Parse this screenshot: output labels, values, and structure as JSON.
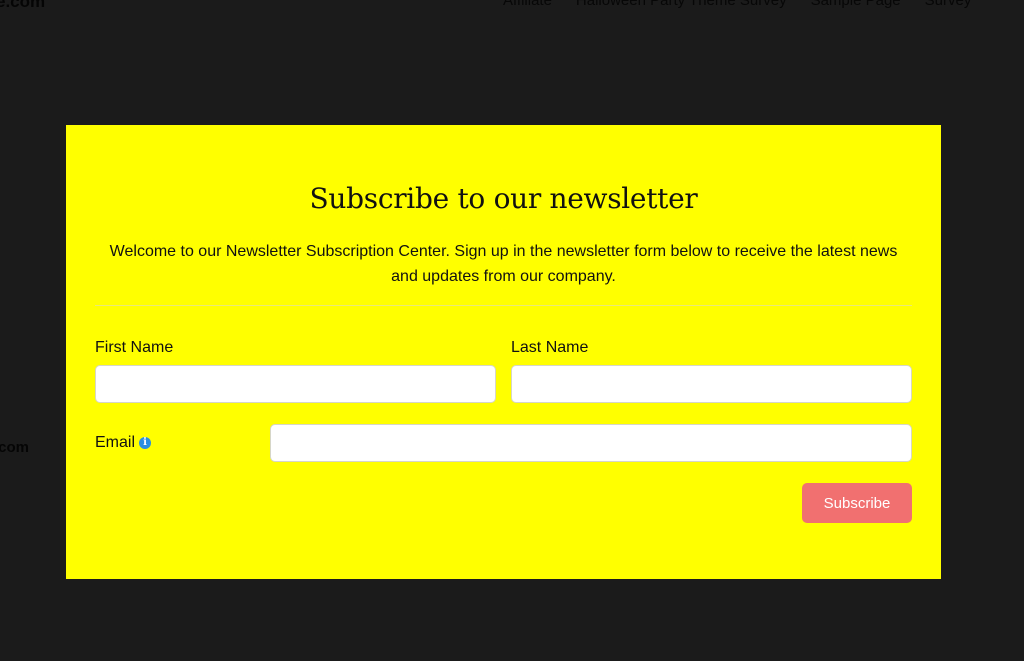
{
  "site": {
    "title_fragment": "e.com",
    "side_fragment": ".com",
    "nav": [
      "Affiliate",
      "Halloween Party Theme Survey",
      "Sample Page",
      "Survey"
    ]
  },
  "modal": {
    "title": "Subscribe to our newsletter",
    "description": "Welcome to our Newsletter Subscription Center. Sign up in the newsletter form below to receive the latest news and updates from our company.",
    "first_name": {
      "label": "First Name",
      "value": "",
      "placeholder": ""
    },
    "last_name": {
      "label": "Last Name",
      "value": "",
      "placeholder": ""
    },
    "email": {
      "label": "Email",
      "value": "",
      "placeholder": ""
    },
    "info_icon": "info-icon",
    "subscribe_label": "Subscribe"
  },
  "colors": {
    "overlay_background": "#1b1b1b",
    "modal_background": "#ffff00",
    "button_background": "#f17070",
    "info_icon": "#2a8ee0"
  }
}
